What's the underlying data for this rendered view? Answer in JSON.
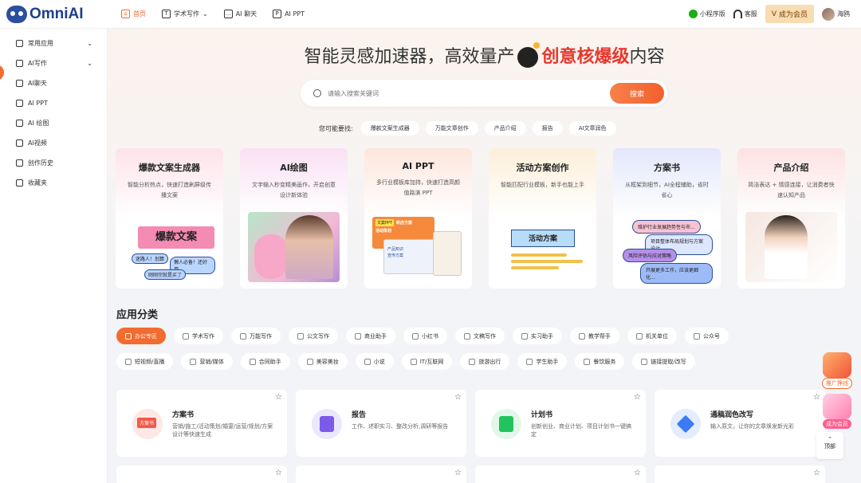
{
  "brand": {
    "name": "OmniAI"
  },
  "nav": [
    {
      "label": "首页",
      "icon": "home-icon",
      "active": true
    },
    {
      "label": "学术写作",
      "icon": "doc-icon",
      "has_dropdown": true
    },
    {
      "label": "AI 聊天",
      "icon": "chat-icon"
    },
    {
      "label": "AI PPT",
      "icon": "ppt-icon"
    }
  ],
  "topright": {
    "miniprogram": "小程序版",
    "service": "客服",
    "vip": "成为会员",
    "username": "海鸥"
  },
  "sidebar": [
    {
      "label": "常用应用",
      "icon": "doc-icon",
      "expandable": true
    },
    {
      "label": "AI写作",
      "icon": "pen-icon",
      "expandable": true
    },
    {
      "label": "AI聊天",
      "icon": "chat-icon"
    },
    {
      "label": "AI PPT",
      "icon": "ppt-icon"
    },
    {
      "label": "AI 绘图",
      "icon": "palette-icon"
    },
    {
      "label": "AI视频",
      "icon": "video-icon"
    },
    {
      "label": "创作历史",
      "icon": "clock-icon"
    },
    {
      "label": "收藏夹",
      "icon": "folder-icon"
    }
  ],
  "hero": {
    "prefix": "智能灵感加速器，高效量产",
    "highlight": "创意核爆级",
    "suffix": "内容"
  },
  "search": {
    "placeholder": "请输入搜索关键词",
    "button": "搜索"
  },
  "suggest": {
    "label": "您可能要找:",
    "chips": [
      "爆款文案生成器",
      "万能文章创作",
      "产品介绍",
      "报告",
      "AI文章润色"
    ]
  },
  "feature_cards": [
    {
      "title": "爆款文案生成器",
      "desc": "智能分析热点，快速打造刷屏级传播文案",
      "art": {
        "headline": "爆款文案",
        "tags": [
          "迷路人！划算",
          "懒人必备！还好用",
          "刚刚完就是买了"
        ]
      }
    },
    {
      "title": "AI绘图",
      "desc": "文字输入秒变精美画作，开启创意设计新体验"
    },
    {
      "title": "AI PPT",
      "desc": "多行业模板库加持，快速打造高颜值路演 PPT",
      "art": {
        "badge": "文案PPT",
        "lines": [
          "新店方案",
          "活动策划",
          "产品知识",
          "宣传方案"
        ]
      }
    },
    {
      "title": "活动方案创作",
      "desc": "智能匹配行业模板，新手也能上手",
      "art": {
        "plan": "活动方案"
      }
    },
    {
      "title": "方案书",
      "desc": "从框架到细节，AI全程辅助，省时省心",
      "art": {
        "pills": [
          "维护行业发展趋势性与市...",
          "项目整体布局规划与方案设计...",
          "风险评估与应对策略",
          "开展更多工作，应该更细化..."
        ]
      }
    },
    {
      "title": "产品介绍",
      "desc": "简洁表达 + 情感连接，让消费者快速认知产品"
    }
  ],
  "section_title": "应用分类",
  "categories": [
    [
      "办公专区",
      "学术写作",
      "万能写作",
      "公文写作",
      "商业助手",
      "小红书",
      "文稿写作",
      "实习助手",
      "教学帮手",
      "机关单位",
      "公众号"
    ],
    [
      "短视频/直播",
      "营销/媒体",
      "合同助手",
      "美容美妆",
      "小说",
      "IT/互联网",
      "旅游出行",
      "学生助手",
      "餐饮服务",
      "链接提取/改写"
    ]
  ],
  "apps": [
    {
      "title": "方案书",
      "desc": "营销/施工/活动策划/婚宴/运营/规划/方案设计等快速生成",
      "icon": "plan-icon",
      "icon_text": "方案书",
      "color": "#f05a4a"
    },
    {
      "title": "报告",
      "desc": "工作、述职实习、整改分析,调研等报告",
      "icon": "report-icon",
      "color": "#7b5be8"
    },
    {
      "title": "计划书",
      "desc": "创新创业、商业计划、项目计划书一键搞定",
      "icon": "plan-check-icon",
      "color": "#22c35e"
    },
    {
      "title": "通稿润色改写",
      "desc": "输入原文，让你的文章焕发新光彩",
      "icon": "diamond-icon",
      "color": "#3b7cf4"
    }
  ],
  "floats": {
    "promo": "推广挣钱",
    "member": "成为会员",
    "top": "顶部"
  },
  "colors": {
    "accent": "#f26b2f",
    "highlight": "#e8372c",
    "brand": "#1f3f8a"
  }
}
